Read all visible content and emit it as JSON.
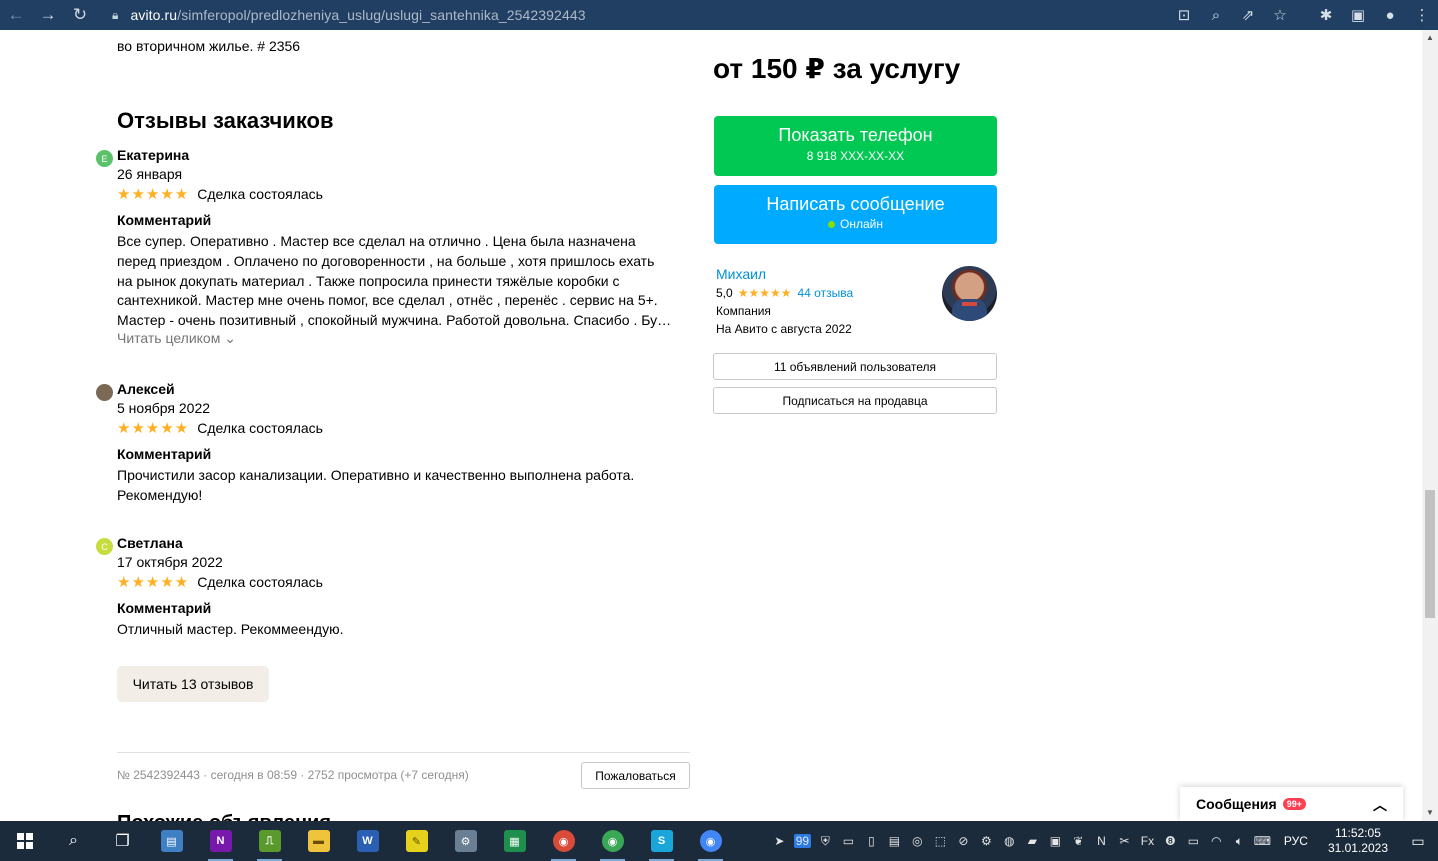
{
  "browser": {
    "url_host": "avito.ru",
    "url_path": "/simferopol/predlozheniya_uslug/uslugi_santehnika_2542392443"
  },
  "listing": {
    "prev_text": "во вторичном жилье. # 2356",
    "reviews_title": "Отзывы заказчиков",
    "reviews": [
      {
        "initial": "Е",
        "avatar_color": "#5cc26a",
        "name": "Екатерина",
        "date": "26 января",
        "stars": "★★★★★",
        "status": "Сделка состоялась",
        "comment_label": "Комментарий",
        "lines": [
          "Все супер. Оперативно . Мастер все сделал на отлично . Цена была назначена",
          "перед приездом . Оплачено по договоренности , на больше , хотя пришлось ехать",
          "на рынок докупать материал . Также попросила принести тяжёлые коробки с",
          "сантехникой. Мастер мне очень помог, все сделал , отнёс , перенёс . сервис на 5+.",
          "Мастер - очень позитивный , спокойный мужчина. Работой довольна. Спасибо . Бу…"
        ],
        "read_more": "Читать целиком ⌄"
      },
      {
        "initial": "",
        "avatar_color": "#7a6a55",
        "name": "Алексей",
        "date": "5 ноября 2022",
        "stars": "★★★★★",
        "status": "Сделка состоялась",
        "comment_label": "Комментарий",
        "lines": [
          "Прочистили засор канализации. Оперативно и качественно выполнена работа.",
          "Рекомендую!"
        ]
      },
      {
        "initial": "С",
        "avatar_color": "#c7dc3f",
        "name": "Светлана",
        "date": "17 октября 2022",
        "stars": "★★★★★",
        "status": "Сделка состоялась",
        "comment_label": "Комментарий",
        "lines": [
          "Отличный мастер. Рекоммеендую."
        ]
      }
    ],
    "more_reviews_btn": "Читать 13 отзывов",
    "ad_meta": "№ 2542392443 · сегодня в 08:59 · 2752 просмотра (+7 сегодня)",
    "complain_btn": "Пожаловаться",
    "similar_title": "Похожие объявления"
  },
  "sidebar": {
    "price": "от 150 ₽ за услугу",
    "phone_btn_label": "Показать телефон",
    "phone_btn_number": "8 918 XXX-XX-XX",
    "message_btn_label": "Написать сообщение",
    "message_btn_status": "Онлайн",
    "seller_name": "Михаил",
    "seller_rating": "5,0",
    "seller_stars": "★★★★★",
    "seller_reviews": "44 отзыва",
    "seller_type": "Компания",
    "seller_since": "На Авито с августа 2022",
    "user_ads_btn": "11 объявлений пользователя",
    "subscribe_btn": "Подписаться на продавца"
  },
  "messages_panel": {
    "label": "Сообщения",
    "badge": "99+"
  },
  "taskbar": {
    "apps": [
      {
        "name": "onenote",
        "glyph": "N",
        "color": "#7719aa"
      },
      {
        "name": "sheets-green",
        "glyph": "⎍",
        "color": "#5a9a2c"
      },
      {
        "name": "explorer",
        "glyph": "▬",
        "color": "#f0c33c"
      },
      {
        "name": "word",
        "glyph": "W",
        "color": "#2b5fb3"
      },
      {
        "name": "sticky",
        "glyph": "✎",
        "color": "#e6d21c"
      },
      {
        "name": "app-tool",
        "glyph": "⚙",
        "color": "#6a7f93"
      },
      {
        "name": "excel",
        "glyph": "▦",
        "color": "#1f8f4e"
      },
      {
        "name": "chrome-1",
        "glyph": "●",
        "color": "#d94a38"
      },
      {
        "name": "chrome-2",
        "glyph": "●",
        "color": "#3aa757"
      },
      {
        "name": "skype-like",
        "glyph": "S",
        "color": "#1aa6d9"
      },
      {
        "name": "chrome-3",
        "glyph": "●",
        "color": "#4285f4"
      }
    ],
    "tray_badge": "99",
    "lang": "РУС",
    "time": "11:52:05",
    "date": "31.01.2023"
  }
}
